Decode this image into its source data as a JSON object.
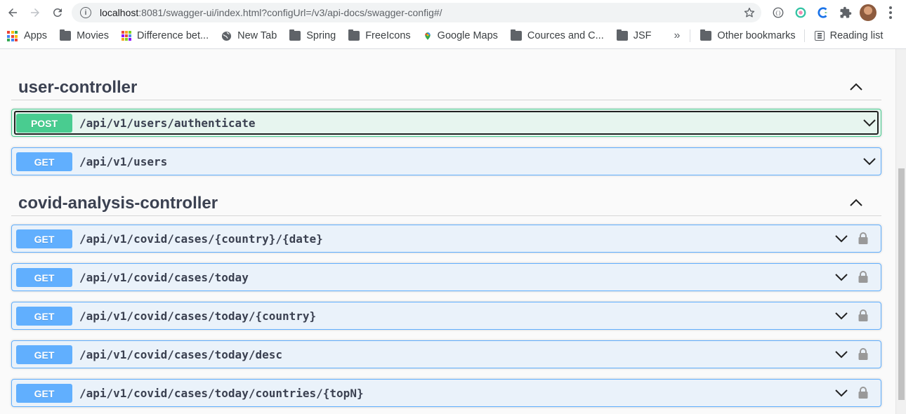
{
  "browser": {
    "url_host": "localhost",
    "url_rest": ":8081/swagger-ui/index.html?configUrl=/v3/api-docs/swagger-config#/",
    "icons": [
      "back-icon",
      "forward-icon",
      "reload-icon",
      "site-info-icon",
      "bookmark-star-icon",
      "extension-icon",
      "profile-avatar",
      "menu-icon"
    ]
  },
  "bookmarks": {
    "items": [
      {
        "label": "Apps",
        "icon": "apps-grid-icon"
      },
      {
        "label": "Movies",
        "icon": "folder-icon"
      },
      {
        "label": "Difference bet...",
        "icon": "site-icon"
      },
      {
        "label": "New Tab",
        "icon": "globe-icon"
      },
      {
        "label": "Spring",
        "icon": "folder-icon"
      },
      {
        "label": "FreeIcons",
        "icon": "folder-icon"
      },
      {
        "label": "Google Maps",
        "icon": "maps-icon"
      },
      {
        "label": "Cources and C...",
        "icon": "folder-icon"
      },
      {
        "label": "JSF",
        "icon": "folder-icon"
      }
    ],
    "more": "»",
    "other": "Other bookmarks",
    "reading_list": "Reading list"
  },
  "swagger": {
    "colors": {
      "get": "#61affe",
      "post": "#49cc90",
      "text": "#3b4151"
    },
    "tags": [
      {
        "name": "user-controller",
        "operations": [
          {
            "method": "POST",
            "path": "/api/v1/users/authenticate",
            "locked": false
          },
          {
            "method": "GET",
            "path": "/api/v1/users",
            "locked": false
          }
        ]
      },
      {
        "name": "covid-analysis-controller",
        "operations": [
          {
            "method": "GET",
            "path": "/api/v1/covid/cases/{country}/{date}",
            "locked": true
          },
          {
            "method": "GET",
            "path": "/api/v1/covid/cases/today",
            "locked": true
          },
          {
            "method": "GET",
            "path": "/api/v1/covid/cases/today/{country}",
            "locked": true
          },
          {
            "method": "GET",
            "path": "/api/v1/covid/cases/today/desc",
            "locked": true
          },
          {
            "method": "GET",
            "path": "/api/v1/covid/cases/today/countries/{topN}",
            "locked": true
          }
        ]
      }
    ]
  }
}
